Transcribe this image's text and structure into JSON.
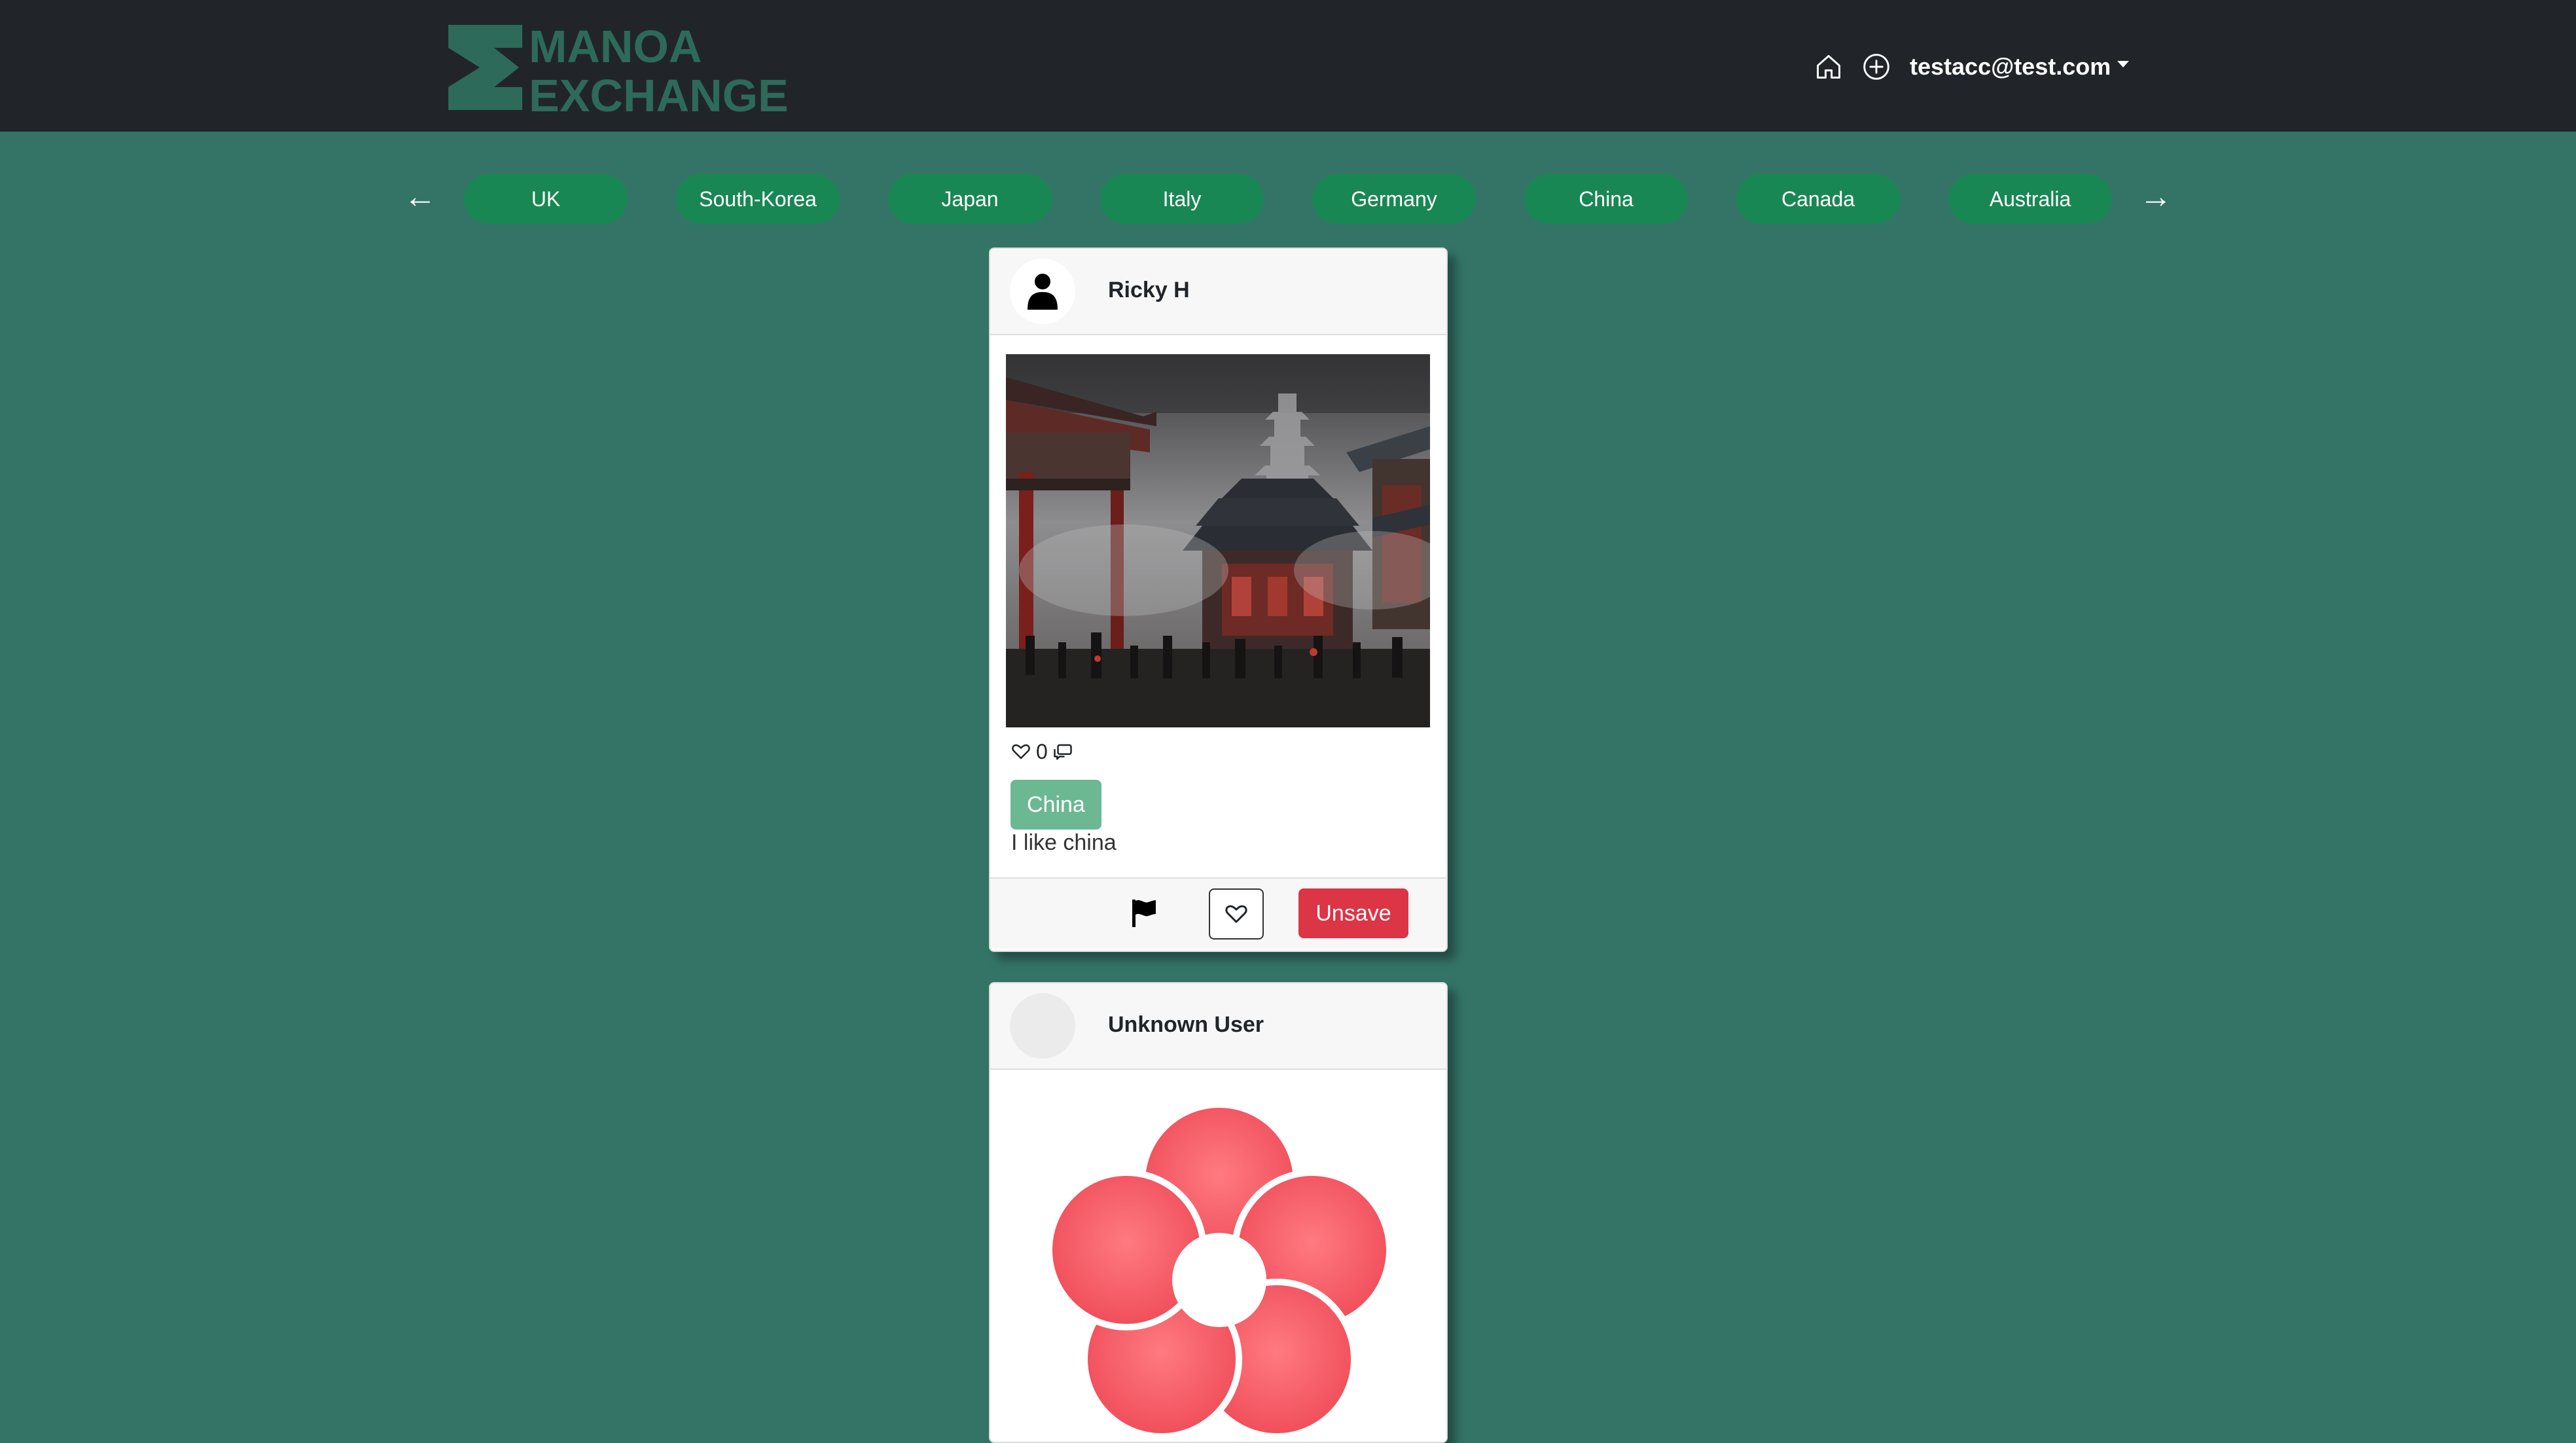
{
  "navbar": {
    "logo_line1": "MANOA",
    "logo_line2": "EXCHANGE",
    "home_icon": "home-icon",
    "add_icon": "plus-circle-icon",
    "user_email": "testacc@test.com"
  },
  "countries": {
    "prev_arrow": "←",
    "next_arrow": "→",
    "items": [
      "UK",
      "South-Korea",
      "Japan",
      "Italy",
      "Germany",
      "China",
      "Canada",
      "Australia"
    ]
  },
  "posts": [
    {
      "author": "Ricky H",
      "avatar_icon": "person-icon",
      "image": "chinese-temple-painting",
      "likes": "0",
      "comment_icon": "comment-icon",
      "tag": "China",
      "caption": "I like china",
      "flag_icon": "flag-icon",
      "like_button_icon": "heart-icon",
      "unsave_label": "Unsave"
    },
    {
      "author": "Unknown User",
      "image": "red-flower-logo"
    }
  ],
  "colors": {
    "background": "#347467",
    "navbar": "#212529",
    "logo": "#2d6a5a",
    "pill": "#198754",
    "tag": "#6cb893",
    "unsave": "#dc3545",
    "flower": "#f25a64"
  }
}
